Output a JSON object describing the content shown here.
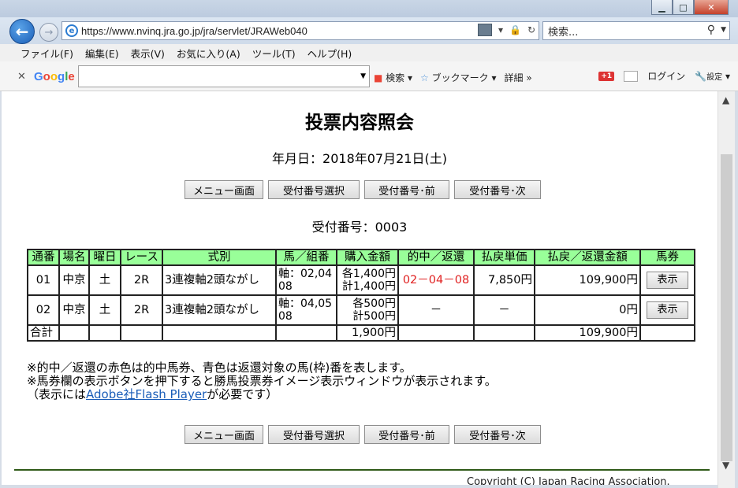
{
  "browser": {
    "address": "https://www.nvinq.jra.go.jp/jra/servlet/JRAWeb040",
    "search_placeholder": "検索...",
    "menu": [
      "ファイル(F)",
      "編集(E)",
      "表示(V)",
      "お気に入り(A)",
      "ツール(T)",
      "ヘルプ(H)"
    ],
    "google": {
      "logo": "Google",
      "search_label": "検索",
      "bookmark_label": "ブックマーク",
      "detail_label": "詳細",
      "login_label": "ログイン",
      "settings_label": "設定",
      "gplus": "+1"
    }
  },
  "page": {
    "title": "投票内容照会",
    "date_line": "年月日：2018年07月21日(土)",
    "receipt_line": "受付番号：0003",
    "buttons": {
      "menu": "メニュー画面",
      "select": "受付番号選択",
      "prev": "受付番号･前",
      "next": "受付番号･次"
    },
    "table": {
      "headers": [
        "通番",
        "場名",
        "曜日",
        "レース",
        "式別",
        "馬／組番",
        "購入金額",
        "的中／返還",
        "払戻単価",
        "払戻／返還金額",
        "馬券"
      ],
      "rows": [
        {
          "no": "01",
          "venue": "中京",
          "day": "土",
          "race": "2R",
          "type": "3連複軸2頭ながし",
          "combo1": "軸：02,04",
          "combo2": "08",
          "amount1": "各1,400円",
          "amount2": "計1,400円",
          "hit": "02－04－08",
          "unit": "7,850円",
          "payout": "109,900円",
          "show": "表示"
        },
        {
          "no": "02",
          "venue": "中京",
          "day": "土",
          "race": "2R",
          "type": "3連複軸2頭ながし",
          "combo1": "軸：04,05",
          "combo2": "08",
          "amount1": "各500円",
          "amount2": "計500円",
          "hit": "－",
          "unit": "－",
          "payout": "0円",
          "show": "表示"
        }
      ],
      "total_label": "合計",
      "total_amount": "1,900円",
      "total_payout": "109,900円"
    },
    "notes": {
      "line1": "※的中／返還の赤色は的中馬券、青色は返還対象の馬(枠)番を表します。",
      "line2": "※馬券欄の表示ボタンを押下すると勝馬投票券イメージ表示ウィンドウが表示されます。",
      "line3_pre": "（表示には",
      "line3_link": "Adobe社Flash Player",
      "line3_post": "が必要です）"
    },
    "copyright": "Copyright (C) Japan Racing Association."
  },
  "colors": {
    "header_bg": "#99ff99",
    "hit_red": "#e02020",
    "rule_green": "#2f5a18"
  }
}
